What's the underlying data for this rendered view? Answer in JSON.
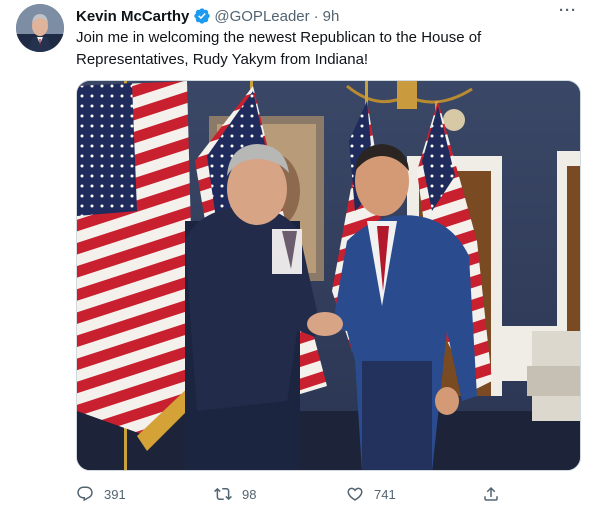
{
  "author": {
    "display_name": "Kevin McCarthy",
    "handle": "@GOPLeader",
    "separator": "·",
    "time": "9h"
  },
  "tweet": {
    "text_line1": "Join me in welcoming the newest Republican to the House of",
    "text_line2": "Representatives, Rudy Yakym from Indiana!"
  },
  "menu": {
    "more_label": "···"
  },
  "actions": {
    "replies": "391",
    "retweets": "98",
    "likes": "741"
  },
  "colors": {
    "verified_blue": "#1d9bf0",
    "secondary_text": "#536471",
    "primary_text": "#0f1419"
  },
  "icons": [
    "verified-badge-icon",
    "more-icon",
    "reply-icon",
    "retweet-icon",
    "like-icon",
    "share-icon"
  ]
}
